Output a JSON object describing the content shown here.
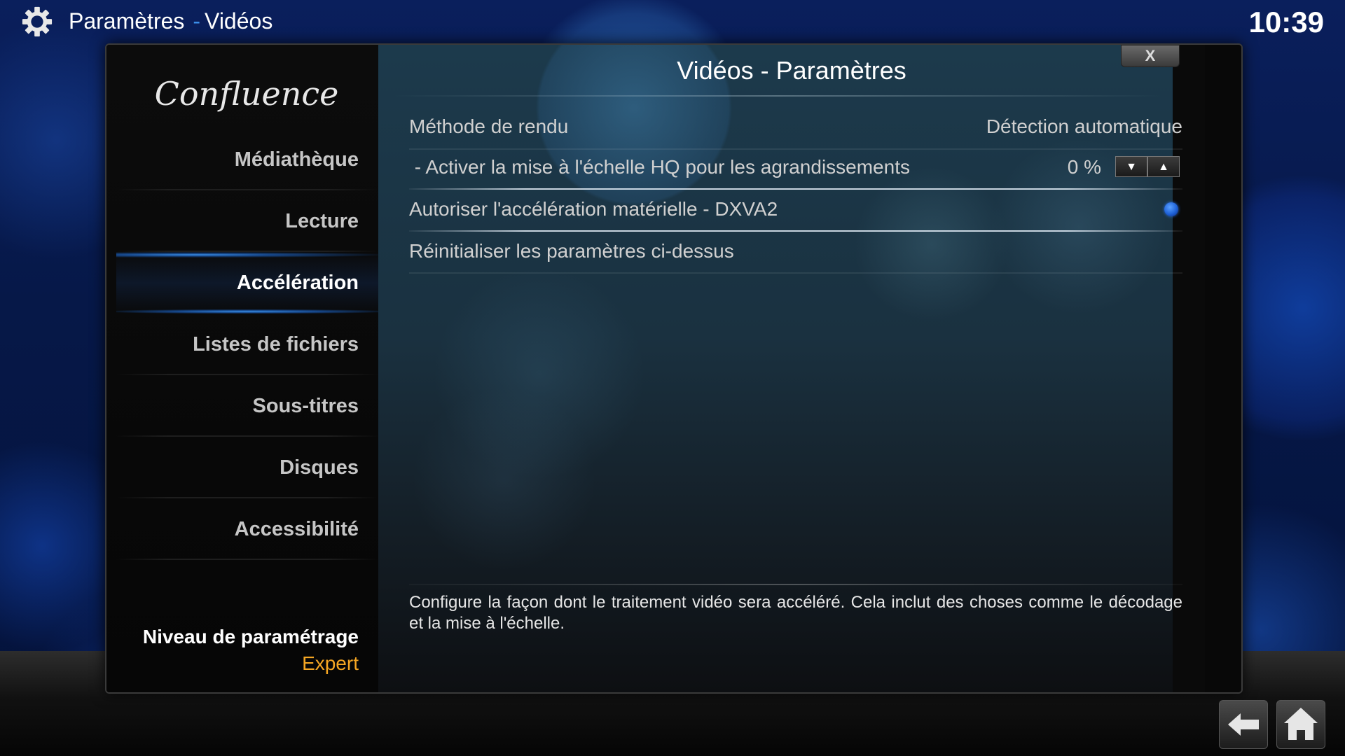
{
  "header": {
    "section": "Paramètres",
    "separator": "-",
    "page": "Vidéos",
    "clock": "10:39",
    "icon": "gear-icon"
  },
  "sidebar": {
    "logo_text": "Confluence",
    "items": [
      {
        "label": "Médiathèque",
        "active": false
      },
      {
        "label": "Lecture",
        "active": false
      },
      {
        "label": "Accélération",
        "active": true
      },
      {
        "label": "Listes de fichiers",
        "active": false
      },
      {
        "label": "Sous-titres",
        "active": false
      },
      {
        "label": "Disques",
        "active": false
      },
      {
        "label": "Accessibilité",
        "active": false
      }
    ],
    "settings_level_label": "Niveau de paramétrage",
    "settings_level_value": "Expert"
  },
  "dialog": {
    "title": "Vidéos - Paramètres",
    "close_label": "X",
    "settings": [
      {
        "label": "Méthode de rendu",
        "value": "Détection automatique"
      },
      {
        "label": " - Activer la mise à l'échelle HQ pour les agrandissements",
        "value": "0 %"
      },
      {
        "label": "Autoriser l'accélération matérielle - DXVA2",
        "enabled": true
      },
      {
        "label": "Réinitialiser les paramètres ci-dessus"
      }
    ],
    "description": "Configure la façon dont le traitement vidéo sera accéléré. Cela inclut des choses comme le décodage et la mise à l'échelle."
  },
  "footer": {
    "back_icon": "back-arrow-icon",
    "home_icon": "home-icon"
  },
  "colors": {
    "accent_blue": "#3b8ee8",
    "level_orange": "#f5a623"
  }
}
